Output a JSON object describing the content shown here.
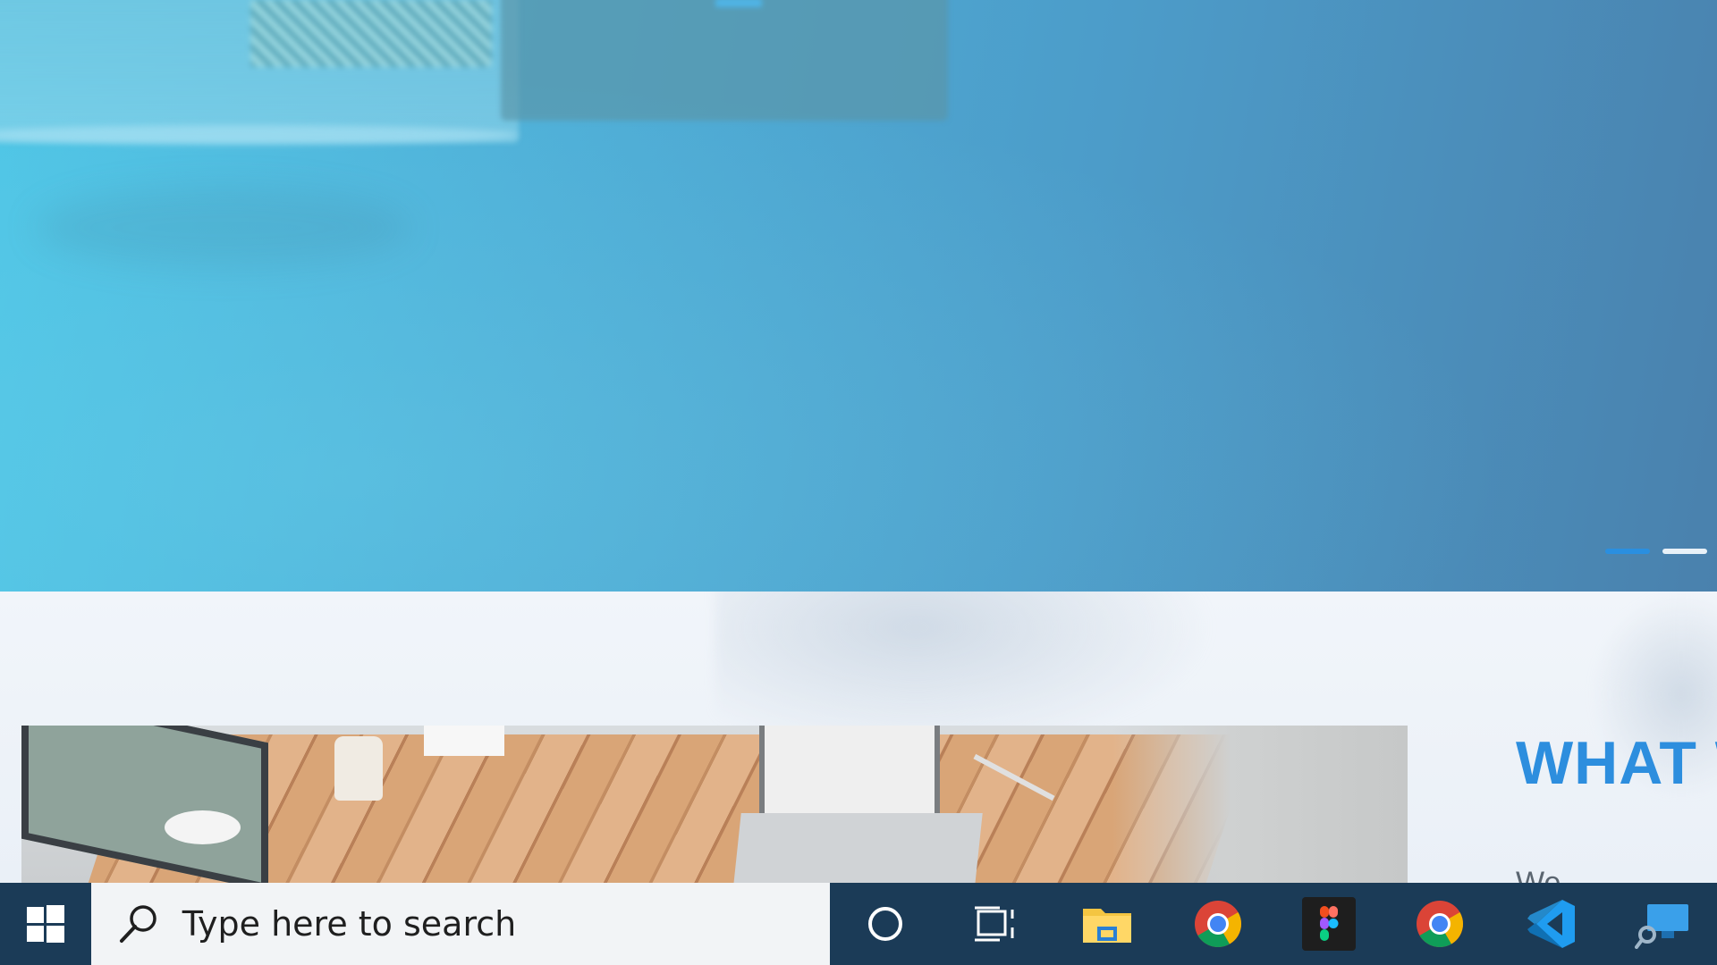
{
  "hero": {
    "slides": [
      {
        "state": "active"
      },
      {
        "state": "inactive"
      }
    ]
  },
  "about": {
    "heading": "WHAT W",
    "text": "We ",
    "image_alt": "desk-workspace-photo"
  },
  "taskbar": {
    "search_placeholder": "Type here to search",
    "icons": [
      {
        "name": "windows-start-icon"
      },
      {
        "name": "cortana-icon"
      },
      {
        "name": "task-view-icon"
      },
      {
        "name": "file-explorer-icon"
      },
      {
        "name": "chrome-icon"
      },
      {
        "name": "figma-icon"
      },
      {
        "name": "chrome-icon"
      },
      {
        "name": "vscode-icon"
      },
      {
        "name": "remote-desktop-icon"
      }
    ]
  },
  "colors": {
    "hero_gradient_start": "#4fc6e6",
    "hero_gradient_end": "#4a81ad",
    "accent": "#2d8ede",
    "slider_active": "#2a8fe0",
    "slider_inactive": "#e8f1f8",
    "taskbar_bg": "#1b3b57",
    "search_bg": "#f2f4f6"
  }
}
